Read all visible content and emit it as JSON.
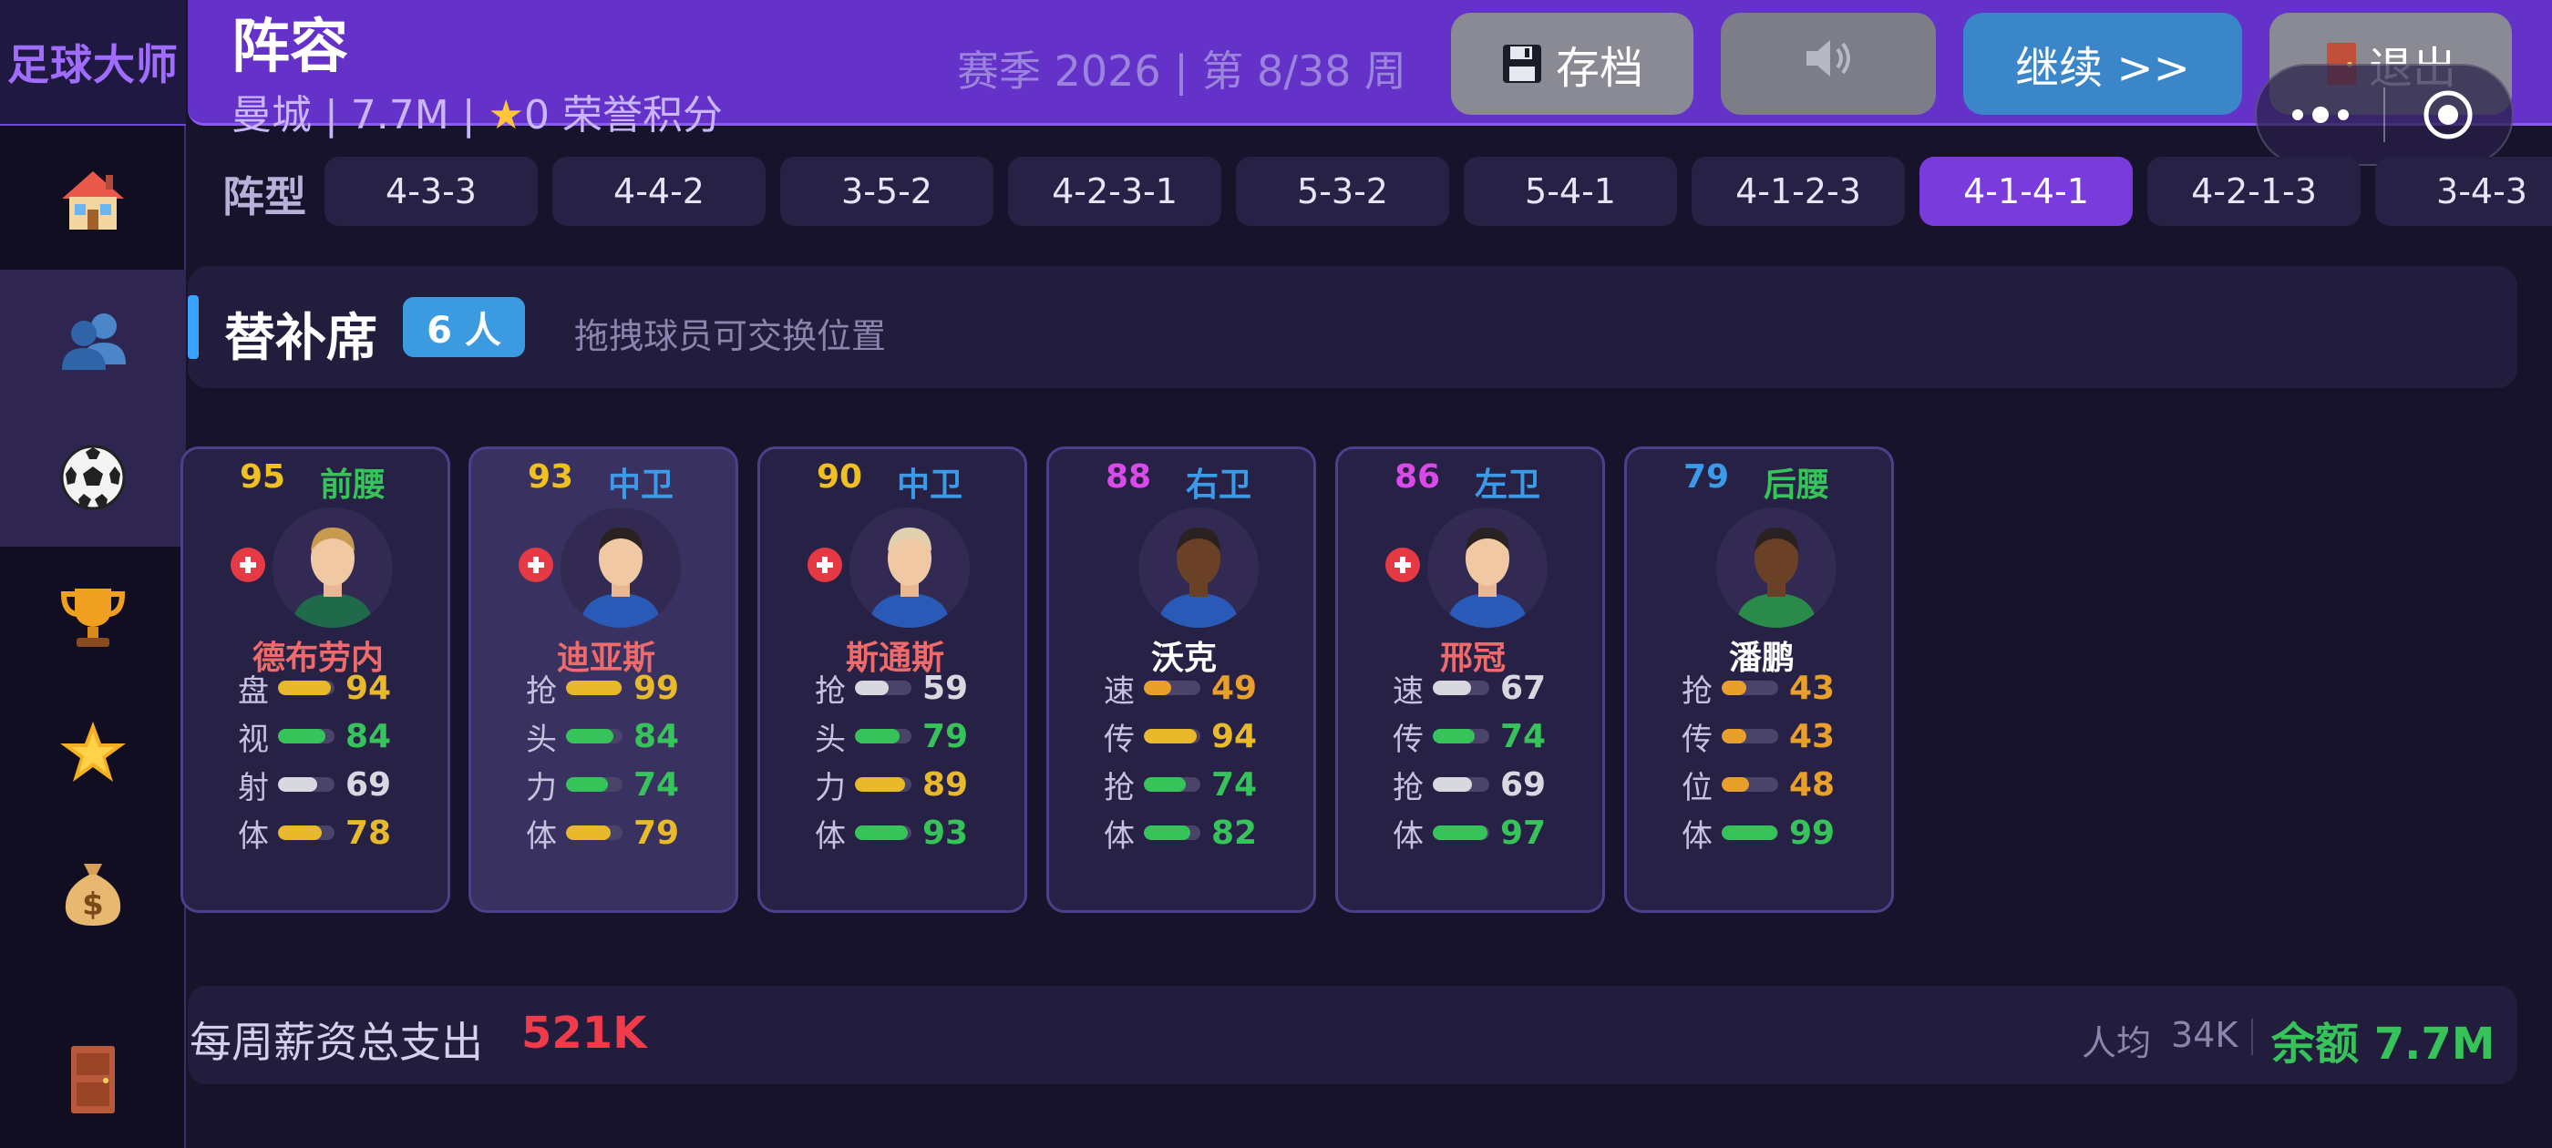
{
  "app": {
    "brand": "足球大师"
  },
  "header": {
    "title": "阵容",
    "club_info_prefix": "曼城 | 7.7M | ",
    "club_info_suffix": "0 荣誉积分",
    "season_info": "赛季 2026 | 第 8/38 周",
    "save_label": "存档",
    "continue_label": "继续 >>",
    "exit_label": "退出"
  },
  "sidebar": {
    "items": [
      {
        "icon": "home-icon"
      },
      {
        "icon": "squad-icon",
        "active": true
      },
      {
        "icon": "football-icon"
      },
      {
        "icon": "trophy-icon"
      },
      {
        "icon": "star-icon"
      },
      {
        "icon": "money-bag-icon"
      },
      {
        "icon": "door-icon"
      }
    ]
  },
  "formation": {
    "label": "阵型",
    "options": [
      "4-3-3",
      "4-4-2",
      "3-5-2",
      "4-2-3-1",
      "5-3-2",
      "5-4-1",
      "4-1-2-3",
      "4-1-4-1",
      "4-2-1-3",
      "3-4-3"
    ],
    "selected": "4-1-4-1"
  },
  "bench": {
    "title": "替补席",
    "count": "6 人",
    "hint": "拖拽球员可交换位置",
    "players": [
      {
        "rating": "95",
        "position": "前腰",
        "name": "德布劳内",
        "injured": true,
        "rating_color": "#f0c020",
        "pos_color": "#36c45a",
        "name_color": "#ef6b6b",
        "stats": [
          {
            "label": "盘",
            "value": "94",
            "color": "#e8b92a"
          },
          {
            "label": "视",
            "value": "84",
            "color": "#36c45a"
          },
          {
            "label": "射",
            "value": "69",
            "color": "#d8d8e0"
          },
          {
            "label": "体",
            "value": "78",
            "color": "#e8b92a"
          }
        ]
      },
      {
        "rating": "93",
        "position": "中卫",
        "name": "迪亚斯",
        "injured": true,
        "rating_color": "#f0c020",
        "pos_color": "#3a9be8",
        "name_color": "#ef6b6b",
        "stats": [
          {
            "label": "抢",
            "value": "99",
            "color": "#e8b92a"
          },
          {
            "label": "头",
            "value": "84",
            "color": "#36c45a"
          },
          {
            "label": "力",
            "value": "74",
            "color": "#36c45a"
          },
          {
            "label": "体",
            "value": "79",
            "color": "#e8b92a"
          }
        ]
      },
      {
        "rating": "90",
        "position": "中卫",
        "name": "斯通斯",
        "injured": true,
        "rating_color": "#f0c020",
        "pos_color": "#3a9be8",
        "name_color": "#ef6b6b",
        "stats": [
          {
            "label": "抢",
            "value": "59",
            "color": "#d8d8e0"
          },
          {
            "label": "头",
            "value": "79",
            "color": "#36c45a"
          },
          {
            "label": "力",
            "value": "89",
            "color": "#e8b92a"
          },
          {
            "label": "体",
            "value": "93",
            "color": "#36c45a"
          }
        ]
      },
      {
        "rating": "88",
        "position": "右卫",
        "name": "沃克",
        "injured": false,
        "rating_color": "#d94ae8",
        "pos_color": "#3a9be8",
        "name_color": "#ffffff",
        "stats": [
          {
            "label": "速",
            "value": "49",
            "color": "#e8a02a"
          },
          {
            "label": "传",
            "value": "94",
            "color": "#e8b92a"
          },
          {
            "label": "抢",
            "value": "74",
            "color": "#36c45a"
          },
          {
            "label": "体",
            "value": "82",
            "color": "#36c45a"
          }
        ]
      },
      {
        "rating": "86",
        "position": "左卫",
        "name": "邢冠",
        "injured": true,
        "rating_color": "#d94ae8",
        "pos_color": "#3a9be8",
        "name_color": "#ef6b6b",
        "stats": [
          {
            "label": "速",
            "value": "67",
            "color": "#d8d8e0"
          },
          {
            "label": "传",
            "value": "74",
            "color": "#36c45a"
          },
          {
            "label": "抢",
            "value": "69",
            "color": "#d8d8e0"
          },
          {
            "label": "体",
            "value": "97",
            "color": "#36c45a"
          }
        ]
      },
      {
        "rating": "79",
        "position": "后腰",
        "name": "潘鹏",
        "injured": false,
        "rating_color": "#3a9be8",
        "pos_color": "#36c45a",
        "name_color": "#ffffff",
        "stats": [
          {
            "label": "抢",
            "value": "43",
            "color": "#e8a02a"
          },
          {
            "label": "传",
            "value": "43",
            "color": "#e8a02a"
          },
          {
            "label": "位",
            "value": "48",
            "color": "#e8a02a"
          },
          {
            "label": "体",
            "value": "99",
            "color": "#36c45a"
          }
        ]
      }
    ]
  },
  "footer": {
    "wage_label": "每周薪资总支出",
    "wage_total": "521K",
    "avg_label": "人均",
    "avg_value": "34K",
    "balance": "余额 7.7M"
  }
}
